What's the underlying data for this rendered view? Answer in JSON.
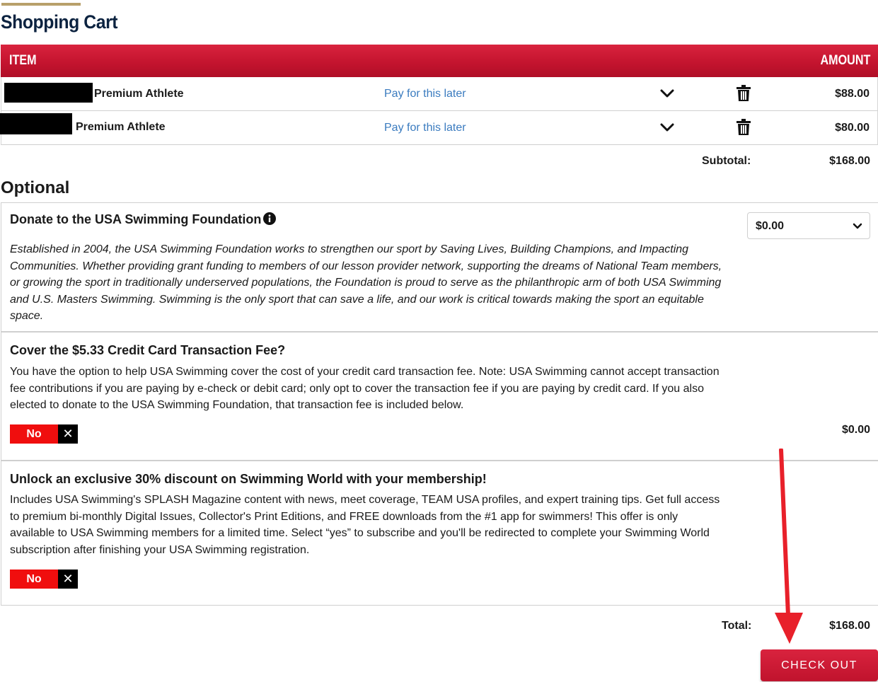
{
  "page": {
    "title": "Shopping Cart"
  },
  "cart": {
    "header": {
      "item": "ITEM",
      "amount": "AMOUNT"
    },
    "rows": [
      {
        "name": "Premium Athlete",
        "pay_later": "Pay for this later",
        "amount": "$88.00"
      },
      {
        "name": "Premium Athlete",
        "pay_later": "Pay for this later",
        "amount": "$80.00"
      }
    ],
    "subtotal_label": "Subtotal:",
    "subtotal_value": "$168.00"
  },
  "optional": {
    "title": "Optional",
    "donate": {
      "heading": "Donate to the USA Swimming Foundation",
      "text": "Established in 2004, the USA Swimming Foundation works to strengthen our sport by Saving Lives, Building Champions, and Impacting Communities. Whether providing grant funding to members of our lesson provider network, supporting the dreams of National Team members, or growing the sport in traditionally underserved populations, the Foundation is proud to serve as the philanthropic arm of both USA Swimming and U.S. Masters Swimming. Swimming is the only sport that can save a life, and our work is critical towards making the sport an equitable space.",
      "selected_amount": "$0.00"
    },
    "fee": {
      "heading": "Cover the $5.33 Credit Card Transaction Fee?",
      "text": "You have the option to help USA Swimming cover the cost of your credit card transaction fee. Note: USA Swimming cannot accept transaction fee contributions if you are paying by e-check or debit card; only opt to cover the transaction fee if you are paying by credit card. If you also elected to donate to the USA Swimming Foundation, that transaction fee is included below.",
      "toggle_label": "No",
      "toggle_x": "✕",
      "value": "$0.00"
    },
    "swimming_world": {
      "heading": "Unlock an exclusive 30% discount on Swimming World with your membership!",
      "text": "Includes USA Swimming's SPLASH Magazine content with news, meet coverage, TEAM USA profiles, and expert training tips. Get full access to premium bi-monthly Digital Issues, Collector's Print Editions, and FREE downloads from the #1 app for swimmers! This offer is only available to USA Swimming members for a limited time. Select “yes” to subscribe and you'll be redirected to complete your Swimming World subscription after finishing your USA Swimming registration.",
      "toggle_label": "No",
      "toggle_x": "✕"
    }
  },
  "totals": {
    "label": "Total:",
    "value": "$168.00"
  },
  "checkout": {
    "label": "CHECK OUT"
  },
  "colors": {
    "brand_red": "#c4142f",
    "toggle_red": "#f00e0e",
    "link_blue": "#3a7bbf",
    "navy": "#0c2340",
    "gold": "#b8a06a"
  },
  "icons": {
    "expand": "chevron-down-icon",
    "delete": "trash-icon",
    "info": "info-circle-icon",
    "annotation": "red-arrow-annotation"
  }
}
